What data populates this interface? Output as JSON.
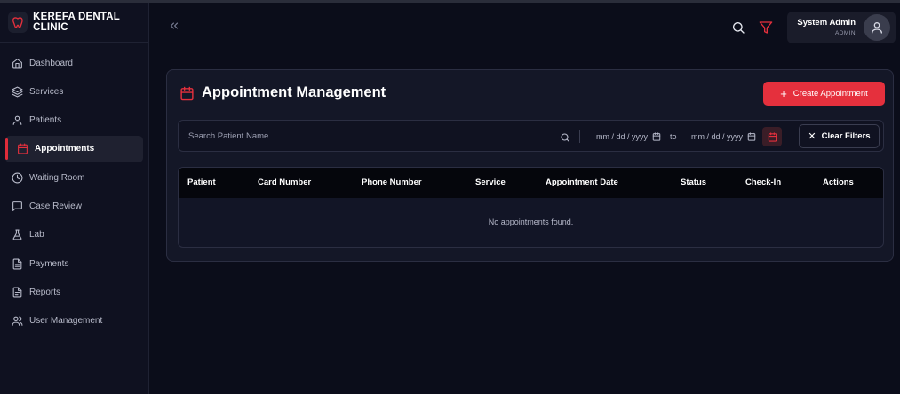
{
  "app": {
    "name": "KEREFA DENTAL CLINIC"
  },
  "sidebar": {
    "items": [
      {
        "label": "Dashboard",
        "icon": "home-icon"
      },
      {
        "label": "Services",
        "icon": "layers-icon"
      },
      {
        "label": "Patients",
        "icon": "user-icon"
      },
      {
        "label": "Appointments",
        "icon": "calendar-icon",
        "active": true
      },
      {
        "label": "Waiting Room",
        "icon": "clock-icon"
      },
      {
        "label": "Case Review",
        "icon": "message-icon"
      },
      {
        "label": "Lab",
        "icon": "flask-icon"
      },
      {
        "label": "Payments",
        "icon": "document-icon"
      },
      {
        "label": "Reports",
        "icon": "report-icon"
      },
      {
        "label": "User Management",
        "icon": "users-icon"
      }
    ]
  },
  "header": {
    "user_name": "System Admin",
    "user_role": "ADMIN"
  },
  "main": {
    "title": "Appointment Management",
    "create_label": "Create Appointment",
    "search_placeholder": "Search Patient Name...",
    "date_from_placeholder": "mm / dd / yyyy",
    "to_label": "to",
    "date_to_placeholder": "mm / dd / yyyy",
    "clear_label": "Clear Filters",
    "columns": [
      "Patient",
      "Card Number",
      "Phone Number",
      "Service",
      "Appointment Date",
      "Status",
      "Check-In",
      "Actions"
    ],
    "empty_message": "No appointments found."
  },
  "colors": {
    "accent": "#e5303d",
    "background": "#0b0d1a",
    "sidebar": "#0f1120",
    "card": "#141727"
  }
}
